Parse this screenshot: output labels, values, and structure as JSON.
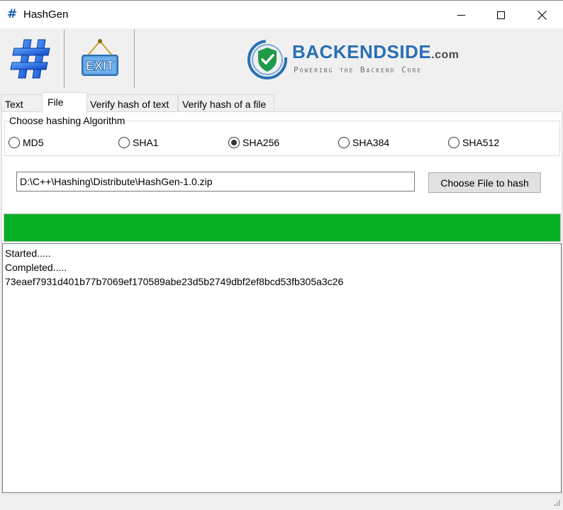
{
  "window": {
    "icon": "hash-icon",
    "title": "HashGen"
  },
  "toolbar": {
    "hash_button_icon": "hash-icon",
    "exit_button_label": "EXIT",
    "brand": {
      "name": "BACKENDSIDE",
      "domain_suffix": ".com",
      "tagline": "Powering the Backend Core",
      "logo_icon": "shield-check-icon"
    }
  },
  "tabs": [
    {
      "label": "Text",
      "active": false
    },
    {
      "label": "File",
      "active": true
    },
    {
      "label": "Verify hash of text",
      "active": false
    },
    {
      "label": "Verify hash of a file",
      "active": false
    }
  ],
  "algorithm_group": {
    "title": "Choose hashing Algorithm",
    "options": [
      {
        "label": "MD5",
        "selected": false
      },
      {
        "label": "SHA1",
        "selected": false
      },
      {
        "label": "SHA256",
        "selected": true
      },
      {
        "label": "SHA384",
        "selected": false
      },
      {
        "label": "SHA512",
        "selected": false
      }
    ]
  },
  "file": {
    "path_value": "D:\\C++\\Hashing\\Distribute\\HashGen-1.0.zip",
    "choose_button_label": "Choose File to hash"
  },
  "progress": {
    "percent": 100,
    "color": "#06b025"
  },
  "output": {
    "lines": [
      "Started.....",
      "Completed.....",
      "73eaef7931d401b77b7069ef170589abe23d5b2749dbf2ef8bcd53fb305a3c26"
    ]
  },
  "colors": {
    "accent": "#2a6fb5",
    "progress": "#06b025"
  }
}
